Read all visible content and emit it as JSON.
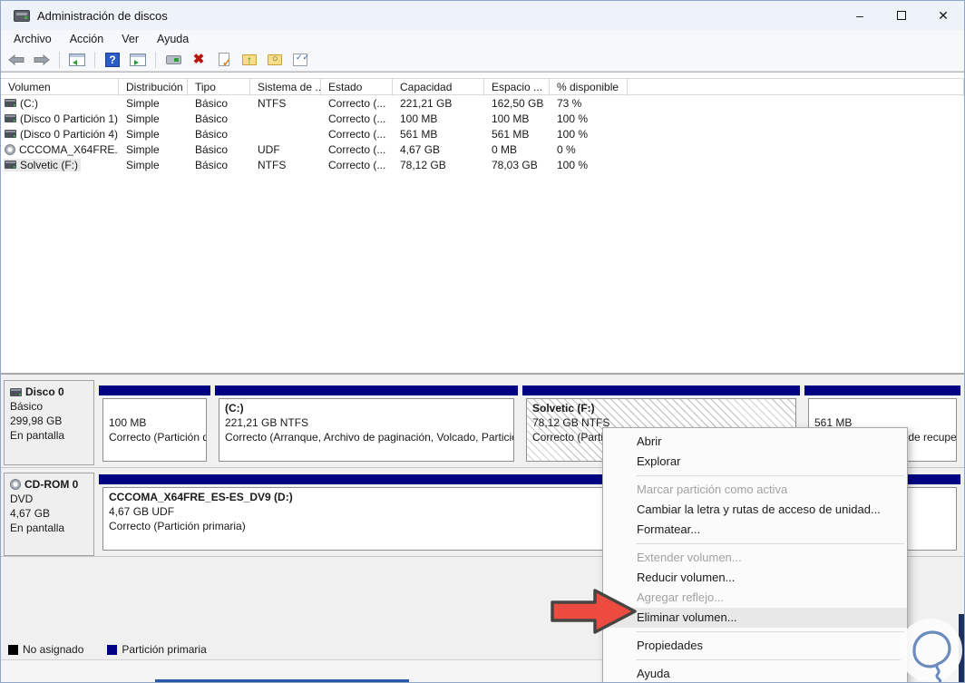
{
  "window": {
    "title": "Administración de discos",
    "controls": {
      "minimize": "–",
      "maximize": "",
      "close": "✕"
    }
  },
  "menu_bar": {
    "items": [
      "Archivo",
      "Acción",
      "Ver",
      "Ayuda"
    ]
  },
  "toolbar": {
    "icons": [
      "back",
      "forward",
      "console-tree",
      "help",
      "action-pane",
      "remote-computer",
      "delete",
      "task-check",
      "folder-open",
      "folder-explore",
      "checklist"
    ]
  },
  "volume_table": {
    "headers": [
      "Volumen",
      "Distribución",
      "Tipo",
      "Sistema de ...",
      "Estado",
      "Capacidad",
      "Espacio ...",
      "% disponible"
    ],
    "rows": [
      {
        "icon": "disk",
        "volumen": "(C:)",
        "distribucion": "Simple",
        "tipo": "Básico",
        "sistema": "NTFS",
        "estado": "Correcto (...",
        "capacidad": "221,21 GB",
        "espacio": "162,50 GB",
        "disponible": "73 %"
      },
      {
        "icon": "disk",
        "volumen": "(Disco 0 Partición 1)",
        "distribucion": "Simple",
        "tipo": "Básico",
        "sistema": "",
        "estado": "Correcto (...",
        "capacidad": "100 MB",
        "espacio": "100 MB",
        "disponible": "100 %"
      },
      {
        "icon": "disk",
        "volumen": "(Disco 0 Partición 4)",
        "distribucion": "Simple",
        "tipo": "Básico",
        "sistema": "",
        "estado": "Correcto (...",
        "capacidad": "561 MB",
        "espacio": "561 MB",
        "disponible": "100 %"
      },
      {
        "icon": "cd",
        "volumen": "CCCOMA_X64FRE...",
        "distribucion": "Simple",
        "tipo": "Básico",
        "sistema": "UDF",
        "estado": "Correcto (...",
        "capacidad": "4,67 GB",
        "espacio": "0 MB",
        "disponible": "0 %"
      },
      {
        "icon": "disk",
        "volumen": "Solvetic (F:)",
        "distribucion": "Simple",
        "tipo": "Básico",
        "sistema": "NTFS",
        "estado": "Correcto (...",
        "capacidad": "78,12 GB",
        "espacio": "78,03 GB",
        "disponible": "100 %",
        "selected": true
      }
    ]
  },
  "disks": [
    {
      "name": "Disco 0",
      "type": "Básico",
      "size": "299,98 GB",
      "status": "En pantalla",
      "icon": "disk",
      "partitions": [
        {
          "label": "",
          "size_line": "100 MB",
          "status_line": "Correcto (Partición del sistema)"
        },
        {
          "label": "(C:)",
          "size_line": "221,21 GB NTFS",
          "status_line": "Correcto (Arranque, Archivo de paginación, Volcado, Partición primaria)"
        },
        {
          "label": "Solvetic  (F:)",
          "size_line": "78,12 GB NTFS",
          "status_line": "Correcto (Partición primaria)",
          "hatched": true
        },
        {
          "label": "",
          "size_line": "561 MB",
          "status_line": "Correcto (Partición de recuperación)"
        }
      ]
    },
    {
      "name": "CD-ROM 0",
      "type": "DVD",
      "size": "4,67 GB",
      "status": "En pantalla",
      "icon": "cd",
      "partitions": [
        {
          "label": "CCCOMA_X64FRE_ES-ES_DV9  (D:)",
          "size_line": "4,67 GB UDF",
          "status_line": "Correcto (Partición primaria)"
        }
      ]
    }
  ],
  "context_menu": {
    "items": [
      {
        "label": "Abrir",
        "enabled": true
      },
      {
        "label": "Explorar",
        "enabled": true
      },
      {
        "label": "Marcar partición como activa",
        "enabled": false
      },
      {
        "label": "Cambiar la letra y rutas de acceso de unidad...",
        "enabled": true
      },
      {
        "label": "Formatear...",
        "enabled": true
      },
      {
        "label": "Extender volumen...",
        "enabled": false
      },
      {
        "label": "Reducir volumen...",
        "enabled": true
      },
      {
        "label": "Agregar reflejo...",
        "enabled": false
      },
      {
        "label": "Eliminar volumen...",
        "enabled": true,
        "highlighted": true
      },
      {
        "label": "Propiedades",
        "enabled": true
      },
      {
        "label": "Ayuda",
        "enabled": true
      }
    ]
  },
  "legend": [
    {
      "label": "No asignado",
      "color": "#000000"
    },
    {
      "label": "Partición primaria",
      "color": "#000082"
    }
  ],
  "colors": {
    "partition_primary": "#000082",
    "unallocated": "#000000",
    "arrow_red": "#ee4b40",
    "titlebar_bg": "#eef3f9"
  }
}
